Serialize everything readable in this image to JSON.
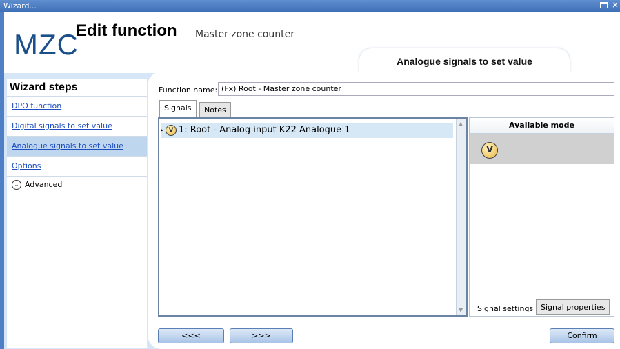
{
  "window": {
    "title": "Wizard..."
  },
  "header": {
    "logo": "MZC",
    "title": "Edit function",
    "subtitle": "Master zone counter",
    "section_tab": "Analogue signals to set value"
  },
  "sidebar": {
    "heading": "Wizard steps",
    "items": [
      {
        "label": "DPO function"
      },
      {
        "label": "Digital signals to set value"
      },
      {
        "label": "Analogue signals to set value"
      },
      {
        "label": "Options"
      }
    ],
    "advanced": "Advanced"
  },
  "form": {
    "function_name_label": "Function name:",
    "function_name_value": "(Fx) Root - Master zone counter"
  },
  "tabs": {
    "signals": "Signals",
    "notes": "Notes"
  },
  "signals_list": [
    {
      "icon_letter": "V",
      "text": "1: Root - Analog input K22 Analogue 1"
    }
  ],
  "available_mode": {
    "heading": "Available mode",
    "icon_letter": "V"
  },
  "bottom_tabs": {
    "signal_settings": "Signal settings",
    "signal_properties": "Signal properties"
  },
  "nav": {
    "prev": "<<<",
    "next": ">>>",
    "confirm": "Confirm"
  },
  "colors": {
    "band": "#d7e6f7",
    "active_step": "#bfd6ef",
    "titlebar": "#4f7fc4",
    "link": "#1f4fbf"
  }
}
